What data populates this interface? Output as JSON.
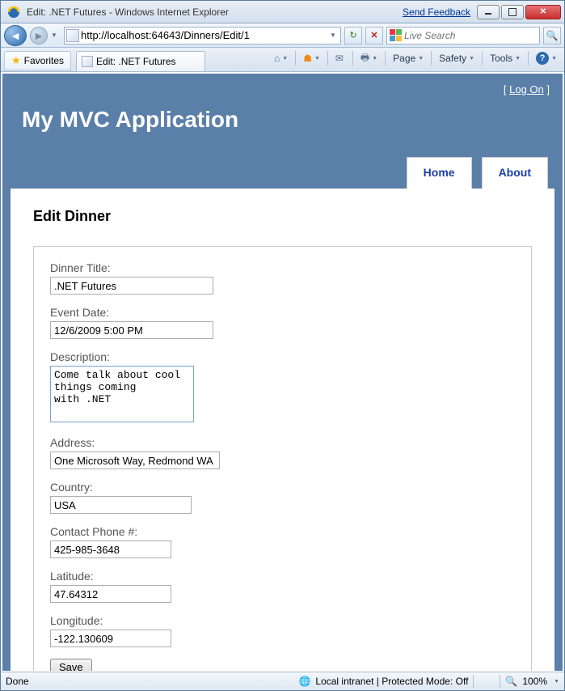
{
  "window": {
    "title": "Edit: .NET Futures - Windows Internet Explorer",
    "send_feedback": "Send Feedback"
  },
  "address": {
    "url": "http://localhost:64643/Dinners/Edit/1"
  },
  "search": {
    "placeholder": "Live Search"
  },
  "favorites_label": "Favorites",
  "tab": {
    "label": "Edit: .NET Futures"
  },
  "toolbar": {
    "page": "Page",
    "safety": "Safety",
    "tools": "Tools"
  },
  "page": {
    "logon": "Log On",
    "app_title": "My MVC Application",
    "nav": {
      "home": "Home",
      "about": "About"
    },
    "heading": "Edit Dinner",
    "form": {
      "title_label": "Dinner Title:",
      "title_value": ".NET Futures",
      "eventdate_label": "Event Date:",
      "eventdate_value": "12/6/2009 5:00 PM",
      "description_label": "Description:",
      "description_value": "Come talk about cool things coming\nwith .NET",
      "address_label": "Address:",
      "address_value": "One Microsoft Way, Redmond WA",
      "country_label": "Country:",
      "country_value": "USA",
      "phone_label": "Contact Phone #:",
      "phone_value": "425-985-3648",
      "lat_label": "Latitude:",
      "lat_value": "47.64312",
      "lon_label": "Longitude:",
      "lon_value": "-122.130609",
      "save": "Save"
    }
  },
  "status": {
    "done": "Done",
    "zone": "Local intranet | Protected Mode: Off",
    "zoom": "100%"
  }
}
